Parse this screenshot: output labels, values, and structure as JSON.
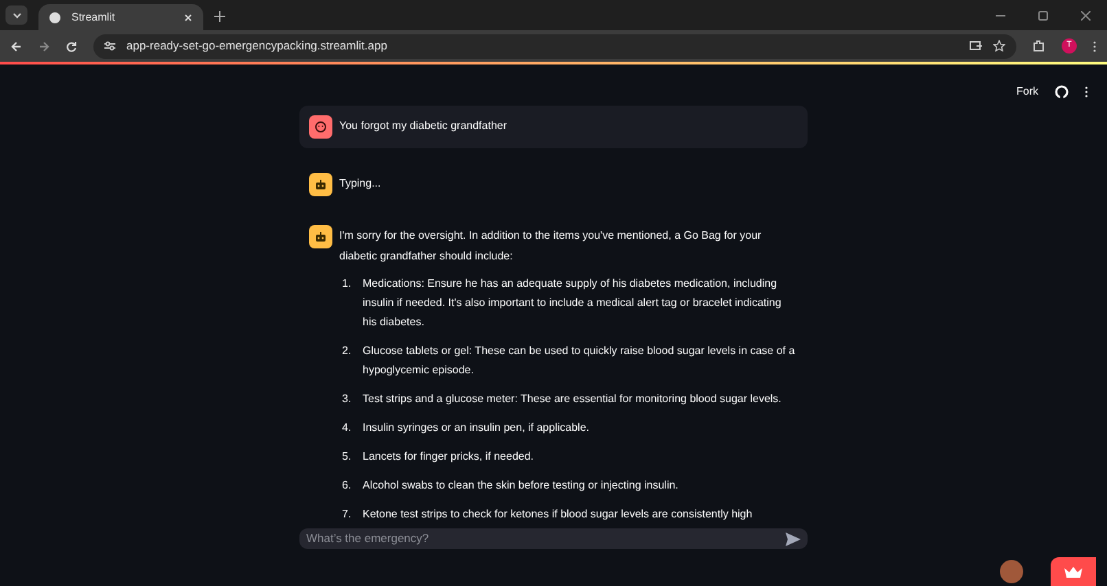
{
  "browser": {
    "tab_title": "Streamlit",
    "url": "app-ready-set-go-emergencypacking.streamlit.app",
    "profile_initial": "T"
  },
  "toolbar": {
    "fork_label": "Fork"
  },
  "messages": [
    {
      "kind": "user",
      "text": "You forgot my diabetic grandfather"
    },
    {
      "kind": "assistant",
      "text": "Typing..."
    },
    {
      "kind": "assistant",
      "text": "I'm sorry for the oversight. In addition to the items you've mentioned, a Go Bag for your diabetic grandfather should include:",
      "list": [
        {
          "number": "1.",
          "text": "Medications: Ensure he has an adequate supply of his diabetes medication, including insulin if needed. It's also important to include a medical alert tag or bracelet indicating his diabetes."
        },
        {
          "number": "2.",
          "text": "Glucose tablets or gel: These can be used to quickly raise blood sugar levels in case of a hypoglycemic episode."
        },
        {
          "number": "3.",
          "text": "Test strips and a glucose meter: These are essential for monitoring blood sugar levels."
        },
        {
          "number": "4.",
          "text": "Insulin syringes or an insulin pen, if applicable."
        },
        {
          "number": "5.",
          "text": "Lancets for finger pricks, if needed."
        },
        {
          "number": "6.",
          "text": "Alcohol swabs to clean the skin before testing or injecting insulin."
        },
        {
          "number": "7.",
          "text": "Ketone test strips to check for ketones if blood sugar levels are consistently high"
        }
      ]
    }
  ],
  "chat_input": {
    "placeholder": "What’s the emergency?"
  }
}
